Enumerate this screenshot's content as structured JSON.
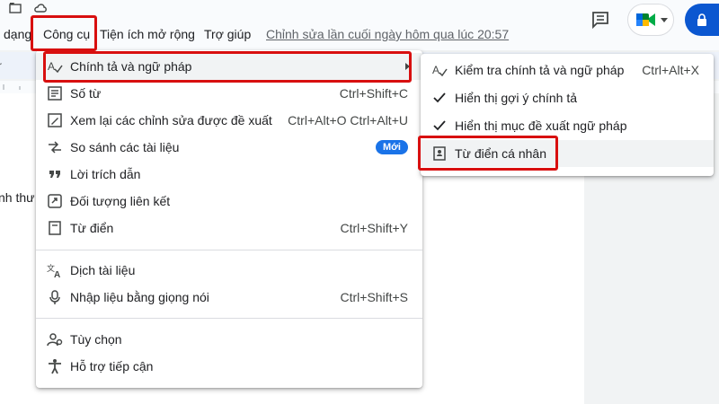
{
  "colors": {
    "accent": "#d80f0f",
    "badge": "#1a73e8",
    "share": "#0b57d0"
  },
  "menubar": {
    "format_partial": "dạng",
    "tools": "Công cụ",
    "extensions": "Tiện ích mở rộng",
    "help": "Trợ giúp",
    "last_edit": "Chỉnh sửa lần cuối ngày hôm qua lúc 20:57"
  },
  "document": {
    "text_partial": "nh thư"
  },
  "toolbar": {
    "partial_label": "r"
  },
  "tools_menu": {
    "items": [
      {
        "label": "Chính tả và ngữ pháp",
        "icon": "spellcheck-icon",
        "has_submenu": true
      },
      {
        "label": "Số từ",
        "icon": "word-count-icon",
        "shortcut": "Ctrl+Shift+C"
      },
      {
        "label": "Xem lại các chỉnh sửa được đề xuất",
        "icon": "review-edits-icon",
        "shortcut": "Ctrl+Alt+O Ctrl+Alt+U"
      },
      {
        "label": "So sánh các tài liệu",
        "icon": "compare-icon",
        "badge": "Mới"
      },
      {
        "label": "Lời trích dẫn",
        "icon": "quote-icon"
      },
      {
        "label": "Đối tượng liên kết",
        "icon": "linked-objects-icon"
      },
      {
        "label": "Từ điển",
        "icon": "dictionary-icon",
        "shortcut": "Ctrl+Shift+Y"
      },
      {
        "label": "Dịch tài liệu",
        "icon": "translate-icon"
      },
      {
        "label": "Nhập liệu bằng giọng nói",
        "icon": "microphone-icon",
        "shortcut": "Ctrl+Shift+S"
      },
      {
        "label": "Tùy chọn",
        "icon": "preferences-icon"
      },
      {
        "label": "Hỗ trợ tiếp cận",
        "icon": "accessibility-icon"
      }
    ]
  },
  "spell_submenu": {
    "items": [
      {
        "label": "Kiểm tra chính tả và ngữ pháp",
        "icon": "spellcheck-icon",
        "shortcut": "Ctrl+Alt+X"
      },
      {
        "label": "Hiển thị gợi ý chính tả",
        "icon": "check-icon"
      },
      {
        "label": "Hiển thị mục đề xuất ngữ pháp",
        "icon": "check-icon"
      },
      {
        "label": "Từ điển cá nhân",
        "icon": "personal-dictionary-icon"
      }
    ]
  }
}
